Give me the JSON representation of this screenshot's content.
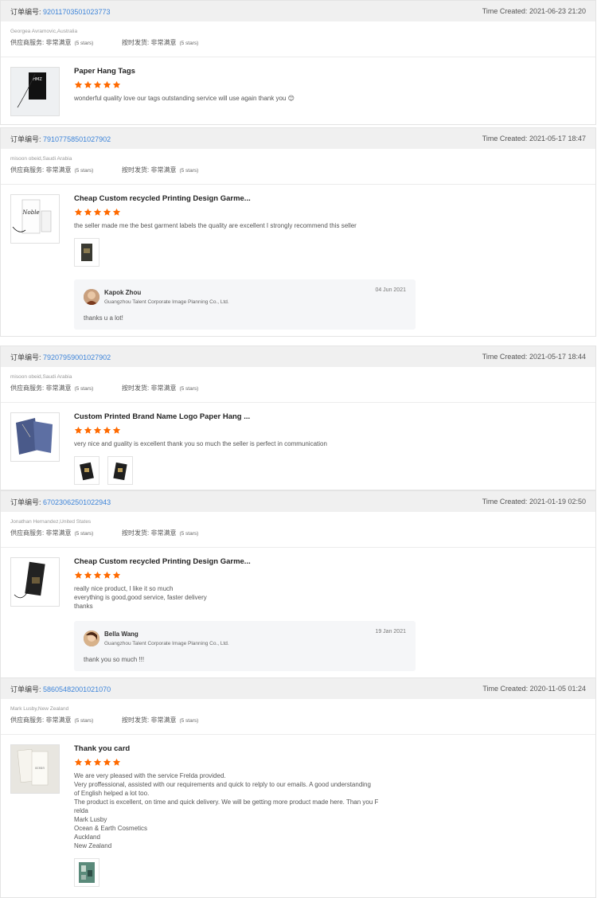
{
  "labels": {
    "order_prefix": "订单编号:",
    "time_prefix": "Time Created:",
    "supplier_service": "供应商服务:",
    "shipping_on_time": "按时发货:",
    "very_satisfied": "非常满意",
    "five_stars": "(5 stars)"
  },
  "colors": {
    "star": "#ff6a00",
    "link": "#3d84d9",
    "header_bg": "#f0f0f0"
  },
  "reviews": [
    {
      "order_number": "92011703501023773",
      "time": "2021-06-23 21:20",
      "buyer": "Georgea Avramovic,Australia",
      "product_title": "Paper Hang Tags",
      "stars": 5,
      "text": "wonderful quality love our tags outstanding service will use again thank you 😊"
    },
    {
      "order_number": "79107758501027902",
      "time": "2021-05-17 18:47",
      "buyer": "misoon obeid,Saudi Arabia",
      "product_title": "Cheap Custom recycled Printing Design Garme...",
      "stars": 5,
      "text": "the seller made me the best garment labels the quality are excellent I strongly recommend this seller",
      "reply": {
        "name": "Kapok Zhou",
        "company": "Guangzhou Talent Corporate Image Planning Co., Ltd.",
        "date": "04 Jun 2021",
        "text": "thanks u a lot!"
      }
    },
    {
      "order_number": "79207959001027902",
      "time": "2021-05-17 18:44",
      "buyer": "misoon obeid,Saudi Arabia",
      "product_title": "Custom Printed Brand Name Logo Paper Hang ...",
      "stars": 5,
      "text": "very nice and guality is excellent thank you so much the seller is perfect in communication"
    },
    {
      "order_number": "67023062501022943",
      "time": "2021-01-19 02:50",
      "buyer": "Jonathan Hernandez,United States",
      "product_title": "Cheap Custom recycled Printing Design Garme...",
      "stars": 5,
      "text": "really nice product, I like it so much\neverything is good,good service, faster delivery\nthanks",
      "reply": {
        "name": "Bella Wang",
        "company": "Guangzhou Talent Corporate Image Planning Co., Ltd.",
        "date": "19 Jan 2021",
        "text": "thank you so much !!!"
      }
    },
    {
      "order_number": "58605482001021070",
      "time": "2020-11-05 01:24",
      "buyer": "Mark Lusby,New Zealand",
      "product_title": "Thank you card",
      "stars": 5,
      "text": "We are very pleased with the service Frelda provided.\nVery proffessional, assisted with our requirements and quick to relply to our emails. A good understanding\nof English helped a lot too.\nThe product is excellent, on time and quick delivery. We will be getting more product made here. Than you F\nrelda\nMark Lusby\nOcean & Earth Cosmetics\nAuckland\nNew Zealand"
    }
  ]
}
